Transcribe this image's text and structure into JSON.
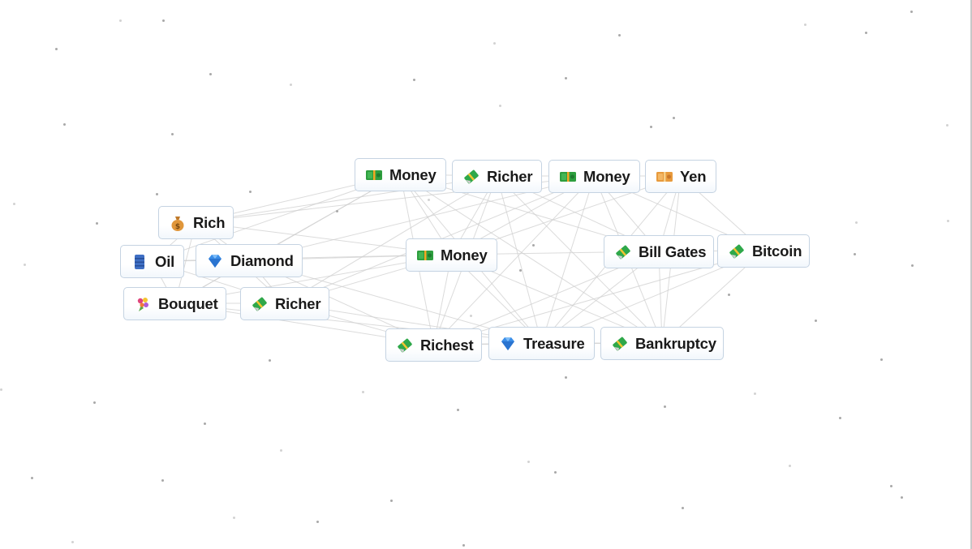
{
  "app": "Infinite Craft canvas",
  "colors": {
    "background": "#ffffff",
    "node_border": "#c5d3e2",
    "edge": "#cfcfcf",
    "text": "#1a1a1a"
  },
  "elements": [
    {
      "id": "money-1",
      "label": "Money",
      "icon": "money-banknote-icon"
    },
    {
      "id": "richer-1",
      "label": "Richer",
      "icon": "money-with-wings-icon"
    },
    {
      "id": "money-2",
      "label": "Money",
      "icon": "money-banknote-icon"
    },
    {
      "id": "yen",
      "label": "Yen",
      "icon": "yen-banknote-icon"
    },
    {
      "id": "rich",
      "label": "Rich",
      "icon": "money-bag-icon"
    },
    {
      "id": "oil",
      "label": "Oil",
      "icon": "oil-drum-icon"
    },
    {
      "id": "diamond",
      "label": "Diamond",
      "icon": "gem-icon"
    },
    {
      "id": "money-3",
      "label": "Money",
      "icon": "money-banknote-icon"
    },
    {
      "id": "bill-gates",
      "label": "Bill Gates",
      "icon": "money-with-wings-icon"
    },
    {
      "id": "bitcoin",
      "label": "Bitcoin",
      "icon": "money-with-wings-icon"
    },
    {
      "id": "bouquet",
      "label": "Bouquet",
      "icon": "bouquet-icon"
    },
    {
      "id": "richer-2",
      "label": "Richer",
      "icon": "money-with-wings-icon"
    },
    {
      "id": "richest",
      "label": "Richest",
      "icon": "money-with-wings-icon"
    },
    {
      "id": "treasure",
      "label": "Treasure",
      "icon": "gem-icon"
    },
    {
      "id": "bankruptcy",
      "label": "Bankruptcy",
      "icon": "money-with-wings-icon"
    }
  ]
}
